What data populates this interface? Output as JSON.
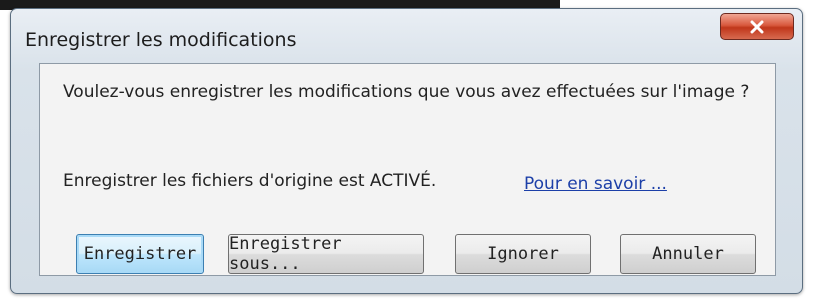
{
  "dialog": {
    "title": "Enregistrer les modifications",
    "close_icon": "close-icon",
    "message": "Voulez-vous enregistrer les modifications que vous avez effectuées sur l'image ?",
    "info": "Enregistrer les fichiers d'origine est ACTIVÉ.",
    "learn_more_link": "Pour en savoir ...",
    "buttons": {
      "save": "Enregistrer",
      "save_as": "Enregistrer sous...",
      "ignore": "Ignorer",
      "cancel": "Annuler"
    },
    "colors": {
      "close_button": "#d9593e",
      "link": "#1c3fa8",
      "default_button_border": "#3c7fb1"
    }
  }
}
